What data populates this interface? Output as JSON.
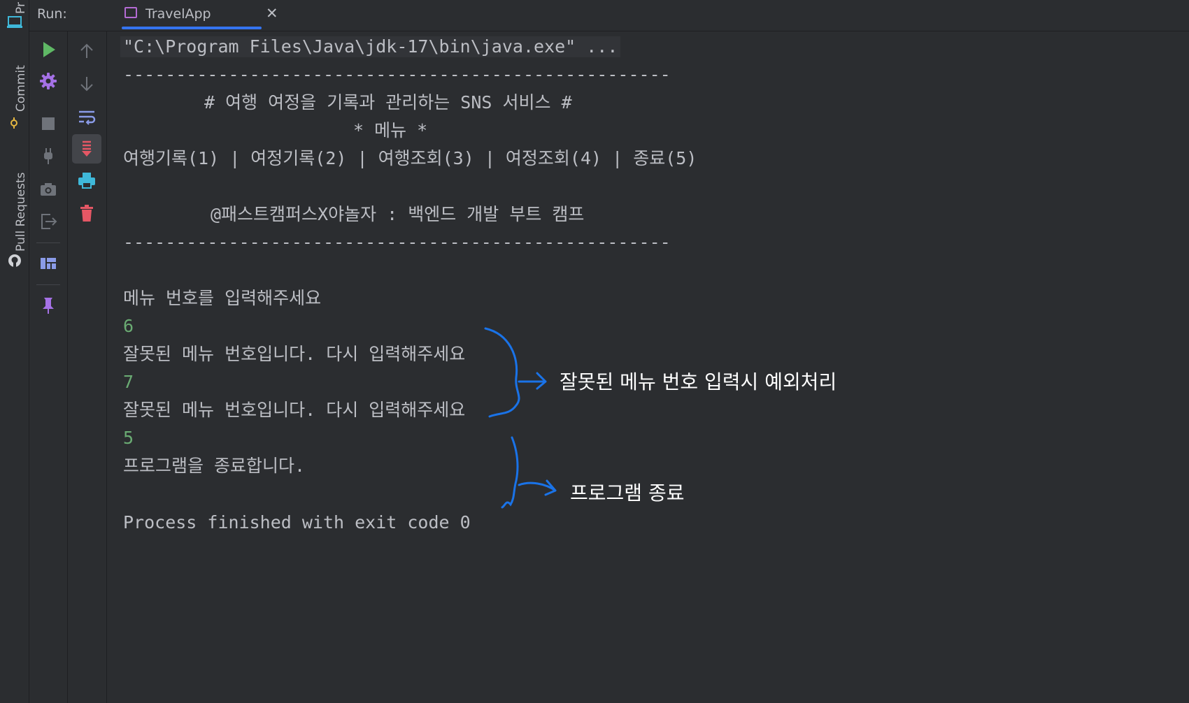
{
  "side_strip": {
    "project_label": "Pr",
    "commit_label": "Commit",
    "pull_requests_label": "Pull Requests"
  },
  "run_header": {
    "label": "Run:",
    "tab_label": "TravelApp",
    "close_glyph": "✕"
  },
  "toolbar_icons": {
    "column1": [
      "rerun-icon",
      "settings-icon",
      "stop-icon",
      "plug-icon",
      "camera-icon",
      "exit-icon",
      "layout-icon",
      "pin-icon"
    ],
    "column2": [
      "scroll-up-icon",
      "scroll-down-icon",
      "soft-wrap-icon",
      "scroll-to-end-icon",
      "print-icon",
      "clear-icon"
    ]
  },
  "colors": {
    "background": "#2b2d30",
    "console_text": "#bcbec4",
    "input_text": "#6aab73",
    "run_green": "#5fb865",
    "accent_blue": "#3574f0",
    "annotation_blue": "#1a73e8",
    "clear_red": "#e55765",
    "print_cyan": "#3fb8d9"
  },
  "console": {
    "command": "\"C:\\Program Files\\Java\\jdk-17\\bin\\java.exe\" ...",
    "divider": "----------------------------------------------------",
    "title": "# 여행 여정을 기록과 관리하는 SNS 서비스 #",
    "menu_heading": "* 메뉴 *",
    "menu_options": "여행기록(1) | 여정기록(2) | 여행조회(3) | 여정조회(4) | 종료(5)",
    "credit": "@패스트캠퍼스X야놀자 : 백엔드 개발 부트 캠프",
    "prompt": "메뉴 번호를 입력해주세요",
    "input_1": "6",
    "error_1": "잘못된 메뉴 번호입니다. 다시 입력해주세요",
    "input_2": "7",
    "error_2": "잘못된 메뉴 번호입니다. 다시 입력해주세요",
    "input_3": "5",
    "exit_message": "프로그램을 종료합니다.",
    "process_finished": "Process finished with exit code 0"
  },
  "annotations": {
    "invalid_input": "잘못된 메뉴 번호 입력시 예외처리",
    "program_exit": "프로그램 종료"
  }
}
